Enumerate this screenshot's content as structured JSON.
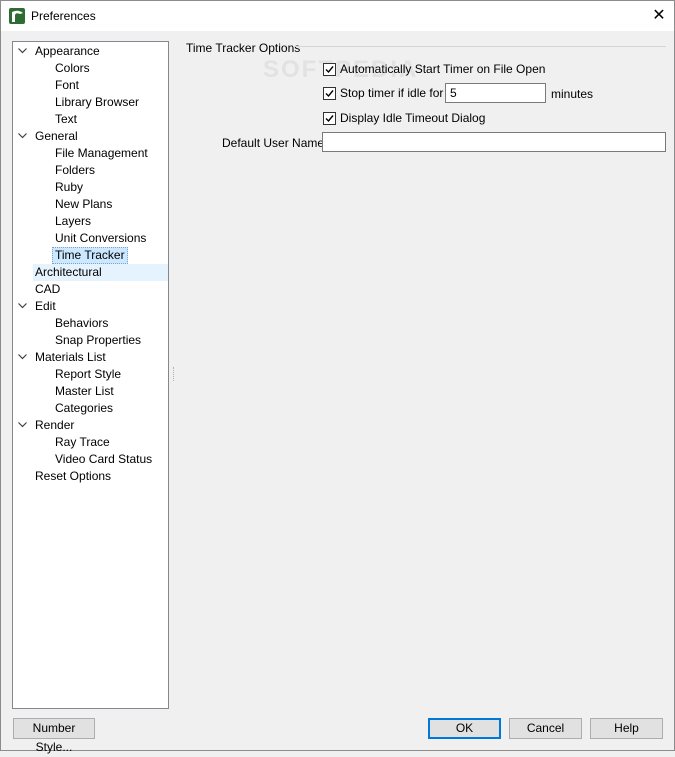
{
  "window": {
    "title": "Preferences",
    "close_glyph": "✕"
  },
  "tree": {
    "items": [
      {
        "label": "Appearance",
        "level": 0,
        "expanded": true
      },
      {
        "label": "Colors",
        "level": 1
      },
      {
        "label": "Font",
        "level": 1
      },
      {
        "label": "Library Browser",
        "level": 1
      },
      {
        "label": "Text",
        "level": 1
      },
      {
        "label": "General",
        "level": 0,
        "expanded": true
      },
      {
        "label": "File Management",
        "level": 1
      },
      {
        "label": "Folders",
        "level": 1
      },
      {
        "label": "Ruby",
        "level": 1
      },
      {
        "label": "New Plans",
        "level": 1
      },
      {
        "label": "Layers",
        "level": 1
      },
      {
        "label": "Unit Conversions",
        "level": 1
      },
      {
        "label": "Time Tracker",
        "level": 1,
        "selected": true
      },
      {
        "label": "Architectural",
        "level": 0,
        "hover": true
      },
      {
        "label": "CAD",
        "level": 0
      },
      {
        "label": "Edit",
        "level": 0,
        "expanded": true
      },
      {
        "label": "Behaviors",
        "level": 1
      },
      {
        "label": "Snap Properties",
        "level": 1
      },
      {
        "label": "Materials List",
        "level": 0,
        "expanded": true
      },
      {
        "label": "Report Style",
        "level": 1
      },
      {
        "label": "Master List",
        "level": 1
      },
      {
        "label": "Categories",
        "level": 1
      },
      {
        "label": "Render",
        "level": 0,
        "expanded": true
      },
      {
        "label": "Ray Trace",
        "level": 1
      },
      {
        "label": "Video Card Status",
        "level": 1
      },
      {
        "label": "Reset Options",
        "level": 0
      }
    ]
  },
  "panel": {
    "section_title": "Time Tracker Options",
    "auto_start": {
      "label": "Automatically Start Timer on File Open",
      "checked": true
    },
    "stop_idle": {
      "label": "Stop timer if idle for",
      "checked": true,
      "value": "5",
      "unit": "minutes"
    },
    "idle_dialog": {
      "label": "Display Idle Timeout Dialog",
      "checked": true
    },
    "default_user": {
      "label": "Default User Name:",
      "value": ""
    }
  },
  "buttons": {
    "number_style": "Number Style...",
    "ok": "OK",
    "cancel": "Cancel",
    "help": "Help"
  },
  "watermark": "SOFTPEDIA",
  "colors": {
    "selection": "#cce8ff",
    "hover": "#e5f3ff",
    "default_button_border": "#0078d7",
    "app_icon": "#2e6b32"
  },
  "icons": {
    "app": "chief-architect-logo-icon",
    "close": "close-icon",
    "expander": "chevron-down-icon",
    "check": "checkmark-icon"
  }
}
